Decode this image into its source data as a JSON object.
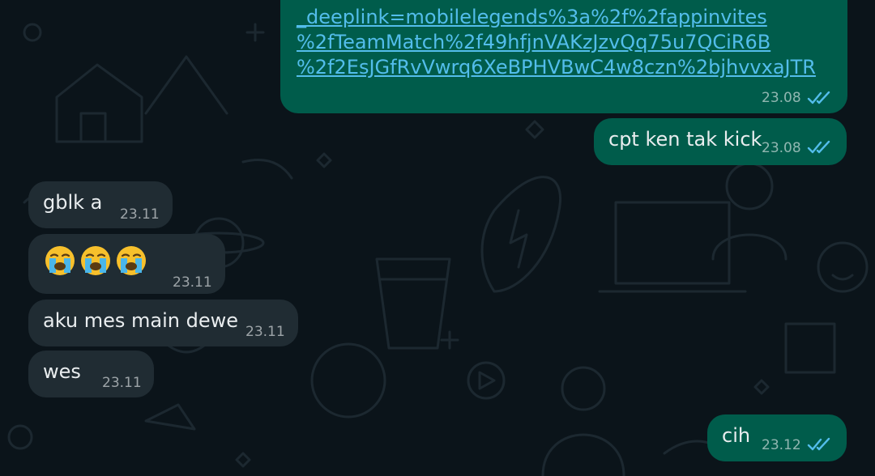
{
  "messages": [
    {
      "id": "link-message",
      "direction": "outgoing",
      "link_lines": [
        "_deeplink=mobilelegends%3a%2f%2fappinvites",
        "%2fTeamMatch%2f49hfjnVAKzJzvQq75u7QCiR6B",
        "%2f2EsJGfRvVwrq6XeBPHVBwC4w8czn%2bjhvvxaJTR"
      ],
      "time": "23.08",
      "status": "read"
    },
    {
      "id": "msg-cpt",
      "direction": "outgoing",
      "text": "cpt ken tak kick",
      "time": "23.08",
      "status": "read"
    },
    {
      "id": "msg-gblk",
      "direction": "incoming",
      "text": "gblk a",
      "time": "23.11"
    },
    {
      "id": "msg-emoji",
      "direction": "incoming",
      "emoji": [
        "crying-face",
        "crying-face",
        "crying-face"
      ],
      "time": "23.11"
    },
    {
      "id": "msg-aku",
      "direction": "incoming",
      "text": "aku mes main dewe",
      "time": "23.11"
    },
    {
      "id": "msg-wes",
      "direction": "incoming",
      "text": "wes",
      "time": "23.11"
    },
    {
      "id": "msg-cih",
      "direction": "outgoing",
      "text": "cih",
      "time": "23.12",
      "status": "read"
    }
  ],
  "colors": {
    "background": "#0b141a",
    "outgoing_bubble": "#005c4b",
    "incoming_bubble": "#202c33",
    "link": "#53bdeb",
    "read_ticks": "#53bdeb"
  }
}
